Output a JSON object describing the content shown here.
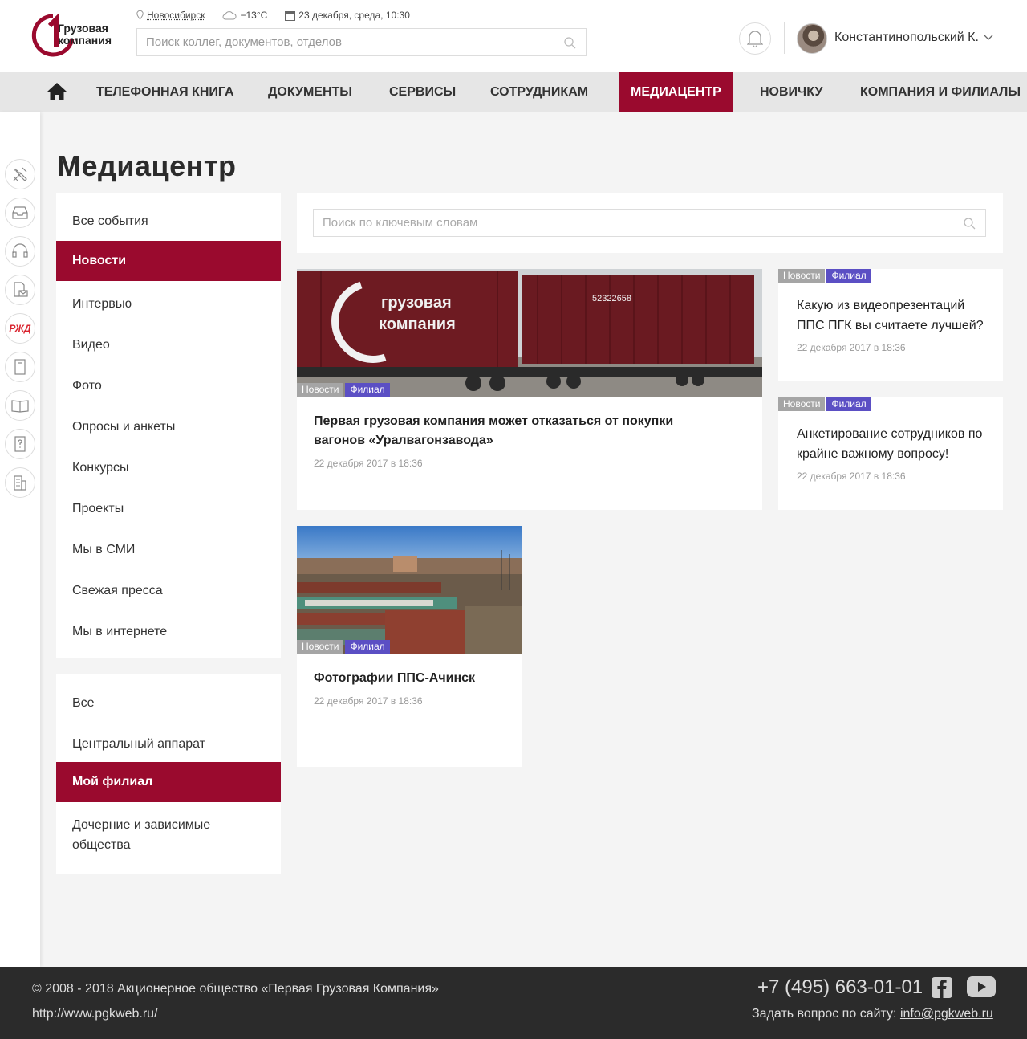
{
  "header": {
    "logo_text_line1": "Грузовая",
    "logo_text_line2": "компания",
    "city": "Новосибирск",
    "weather": "−13°C",
    "datetime": "23 декабря, среда, 10:30",
    "search_placeholder": "Поиск коллег, документов, отделов",
    "user_name": "Константинопольский К."
  },
  "nav": {
    "items": [
      {
        "label": "Телефонная книга",
        "active": false
      },
      {
        "label": "Документы",
        "active": false
      },
      {
        "label": "Сервисы",
        "active": false
      },
      {
        "label": "Сотрудникам",
        "active": false
      },
      {
        "label": "Медиацентр",
        "active": true
      },
      {
        "label": "Новичку",
        "active": false
      },
      {
        "label": "Компания и филиалы",
        "active": false
      }
    ]
  },
  "rail": {
    "icons": [
      "tools-icon",
      "inbox-icon",
      "headset-icon",
      "document-mail-icon",
      "rzd-logo-icon",
      "book-icon",
      "open-book-icon",
      "help-book-icon",
      "building-icon"
    ],
    "rzd_label": "РЖД"
  },
  "page_title": "Медиацентр",
  "category_menu": {
    "items": [
      {
        "label": "Все события",
        "active": false
      },
      {
        "label": "Новости",
        "active": true
      },
      {
        "label": "Интервью",
        "active": false
      },
      {
        "label": "Видео",
        "active": false
      },
      {
        "label": "Фото",
        "active": false
      },
      {
        "label": "Опросы и анкеты",
        "active": false
      },
      {
        "label": "Конкурсы",
        "active": false
      },
      {
        "label": "Проекты",
        "active": false
      },
      {
        "label": "Мы в СМИ",
        "active": false
      },
      {
        "label": "Свежая пресса",
        "active": false
      },
      {
        "label": "Мы в интернете",
        "active": false
      }
    ]
  },
  "scope_menu": {
    "items": [
      {
        "label": "Все",
        "active": false
      },
      {
        "label": "Центральный аппарат",
        "active": false
      },
      {
        "label": "Мой филиал",
        "active": true
      },
      {
        "label": "Дочерние и зависимые общества",
        "active": false
      }
    ]
  },
  "content_search": {
    "placeholder": "Поиск по ключевым словам"
  },
  "articles": [
    {
      "title": "Первая грузовая компания может отказаться от покупки вагонов «Уралвагонзавода»",
      "date": "22 декабря 2017 в 18:36",
      "tags": [
        "Новости",
        "Филиал"
      ],
      "image_text": {
        "brand1": "грузовая",
        "brand2": "компания",
        "wagon_number": "52322658"
      }
    },
    {
      "title": "Какую из видеопрезентаций ППС ПГК вы считаете лучшей?",
      "date": "22 декабря 2017 в 18:36",
      "tags": [
        "Новости",
        "Филиал"
      ]
    },
    {
      "title": "Анкетирование сотрудников по крайне важному вопросу!",
      "date": "22 декабря 2017 в 18:36",
      "tags": [
        "Новости",
        "Филиал"
      ]
    },
    {
      "title": "Фотографии ППС-Ачинск",
      "date": "22 декабря 2017 в 18:36",
      "tags": [
        "Новости",
        "Филиал"
      ]
    }
  ],
  "footer": {
    "copyright": "© 2008 - 2018 Акционерное общество «Первая Грузовая Компания»",
    "url": "http://www.pgkweb.ru/",
    "phone": "+7 (495) 663-01-01",
    "ask_label": "Задать вопрос по сайту:",
    "email": "info@pgkweb.ru"
  },
  "colors": {
    "brand": "#9a0a2e",
    "tag_gray": "#a5a5a5",
    "tag_purple": "#5b4fc4",
    "footer_bg": "#2b2b2b"
  }
}
